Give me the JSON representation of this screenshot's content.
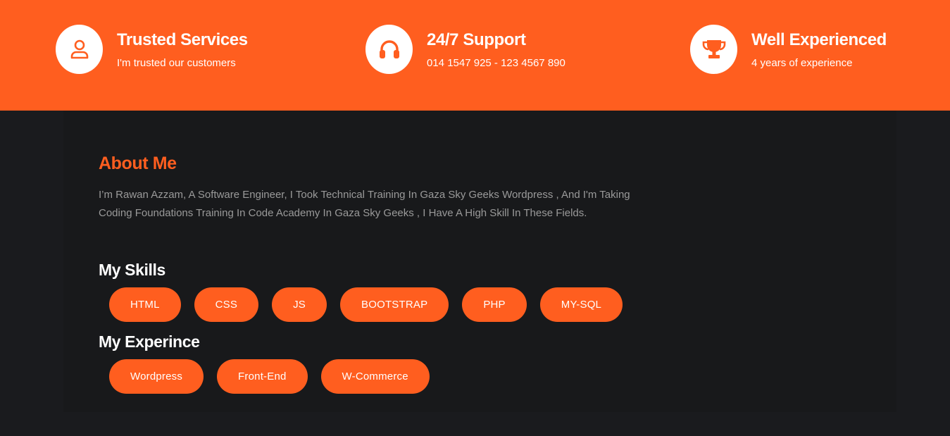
{
  "features": [
    {
      "title": "Trusted Services",
      "subtitle": "I'm trusted our customers",
      "icon": "user-icon"
    },
    {
      "title": "24/7 Support",
      "subtitle": "014 1547 925 - 123 4567 890",
      "icon": "headphones-icon"
    },
    {
      "title": "Well Experienced",
      "subtitle": "4 years of experience",
      "icon": "trophy-icon"
    }
  ],
  "about": {
    "title": "About Me",
    "text": "I’m Rawan Azzam, A Software Engineer, I Took Technical Training In Gaza Sky Geeks Wordpress , And I'm Taking Coding Foundations Training In Code Academy In Gaza Sky Geeks , I Have A High Skill In These Fields."
  },
  "skills": {
    "title": "My Skills",
    "items": [
      "HTML",
      "CSS",
      "JS",
      "BOOTSTRAP",
      "PHP",
      "MY-SQL"
    ]
  },
  "experience": {
    "title": "My Experince",
    "items": [
      "Wordpress",
      "Front-End",
      "W-Commerce"
    ]
  },
  "colors": {
    "accent": "#ff5e1f",
    "background": "#1a1b1e",
    "panel": "#18191b",
    "body_text": "#9a9a9a"
  }
}
